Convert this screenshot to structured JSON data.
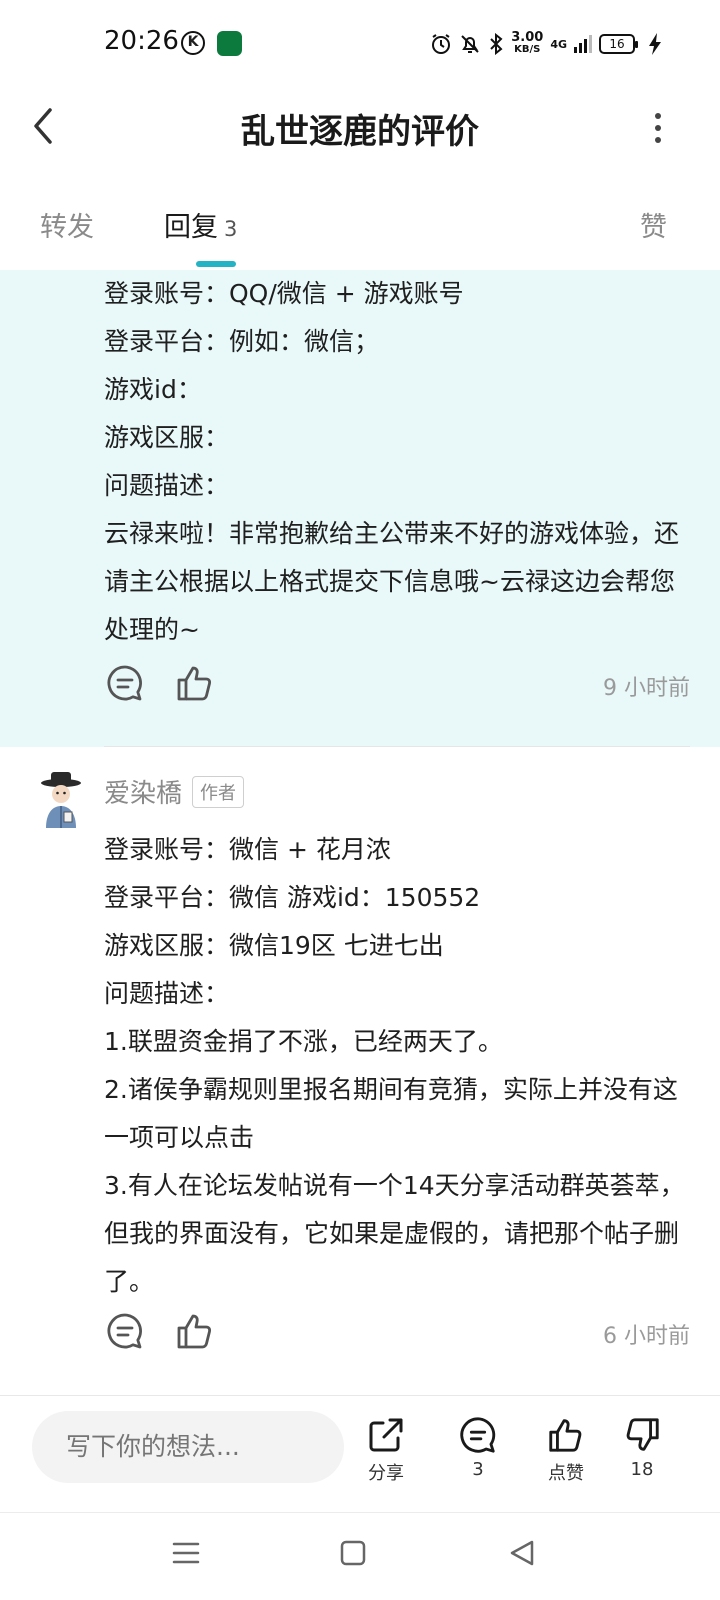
{
  "status_bar": {
    "time": "20:26",
    "k_icon": "K",
    "net_speed_value": "3.00",
    "net_speed_unit": "KB/S",
    "network_type": "4G",
    "battery": "16",
    "icons": [
      "alarm-icon",
      "mute-icon",
      "bluetooth-icon",
      "signal-icon",
      "battery-icon",
      "charging-icon"
    ]
  },
  "header": {
    "title": "乱世逐鹿的评价"
  },
  "tabs": [
    {
      "label": "转发"
    },
    {
      "label": "回复",
      "count": "3"
    },
    {
      "label": "赞"
    }
  ],
  "highlighted_reply": {
    "lines": [
      "登录账号：QQ/微信 + 游戏账号",
      "登录平台：例如：微信；",
      "游戏id：",
      "游戏区服：",
      "问题描述：",
      "云禄来啦！非常抱歉给主公带来不好的游戏体验，还请主公根据以上格式提交下信息哦~云禄这边会帮您处理的~"
    ],
    "time": "9 小时前"
  },
  "reply": {
    "author": "爱染橋",
    "badge": "作者",
    "lines": [
      "登录账号：微信 + 花月浓",
      "登录平台：微信 游戏id：150552",
      "游戏区服：微信19区 七进七出",
      "问题描述：",
      "1.联盟资金捐了不涨，已经两天了。",
      "2.诸侯争霸规则里报名期间有竞猜，实际上并没有这一项可以点击",
      "3.有人在论坛发帖说有一个14天分享活动群英荟萃，但我的界面没有，它如果是虚假的，请把那个帖子删了。"
    ],
    "time": "6 小时前"
  },
  "bottom_bar": {
    "input_placeholder": "写下你的想法...",
    "share_label": "分享",
    "comment_count": "3",
    "like_label": "点赞",
    "dislike_count": "18"
  },
  "colors": {
    "accent": "#24b3c4",
    "highlight_bg": "#e9f8f8"
  }
}
